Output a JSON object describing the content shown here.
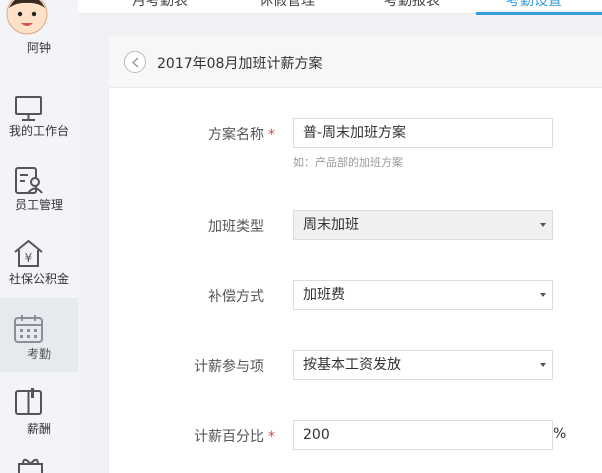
{
  "sidebar": {
    "user_name": "阿钟",
    "items": [
      {
        "label": "我的工作台",
        "icon": "monitor-icon"
      },
      {
        "label": "员工管理",
        "icon": "employee-card-icon"
      },
      {
        "label": "社保公积金",
        "icon": "house-yen-icon"
      },
      {
        "label": "考勤",
        "icon": "calendar-icon",
        "active": true
      },
      {
        "label": "薪酬",
        "icon": "payroll-book-icon"
      }
    ]
  },
  "topbar": {
    "tabs": [
      {
        "label": "月考勤表"
      },
      {
        "label": "休假管理"
      },
      {
        "label": "考勤报表"
      },
      {
        "label": "考勤设置",
        "active": true
      }
    ]
  },
  "panel": {
    "title": "2017年08月加班计薪方案",
    "form": {
      "plan_name": {
        "label": "方案名称",
        "required": "*",
        "value": "普-周末加班方案",
        "hint": "如：产品部的加班方案"
      },
      "overtime_type": {
        "label": "加班类型",
        "value": "周末加班"
      },
      "compensation": {
        "label": "补偿方式",
        "value": "加班费"
      },
      "pay_base": {
        "label": "计薪参与项",
        "value": "按基本工资发放"
      },
      "pay_percent": {
        "label": "计薪百分比",
        "required": "*",
        "value": "200",
        "unit": "%"
      }
    }
  },
  "colors": {
    "accent": "#3a9bdc",
    "required": "#e0483f"
  }
}
